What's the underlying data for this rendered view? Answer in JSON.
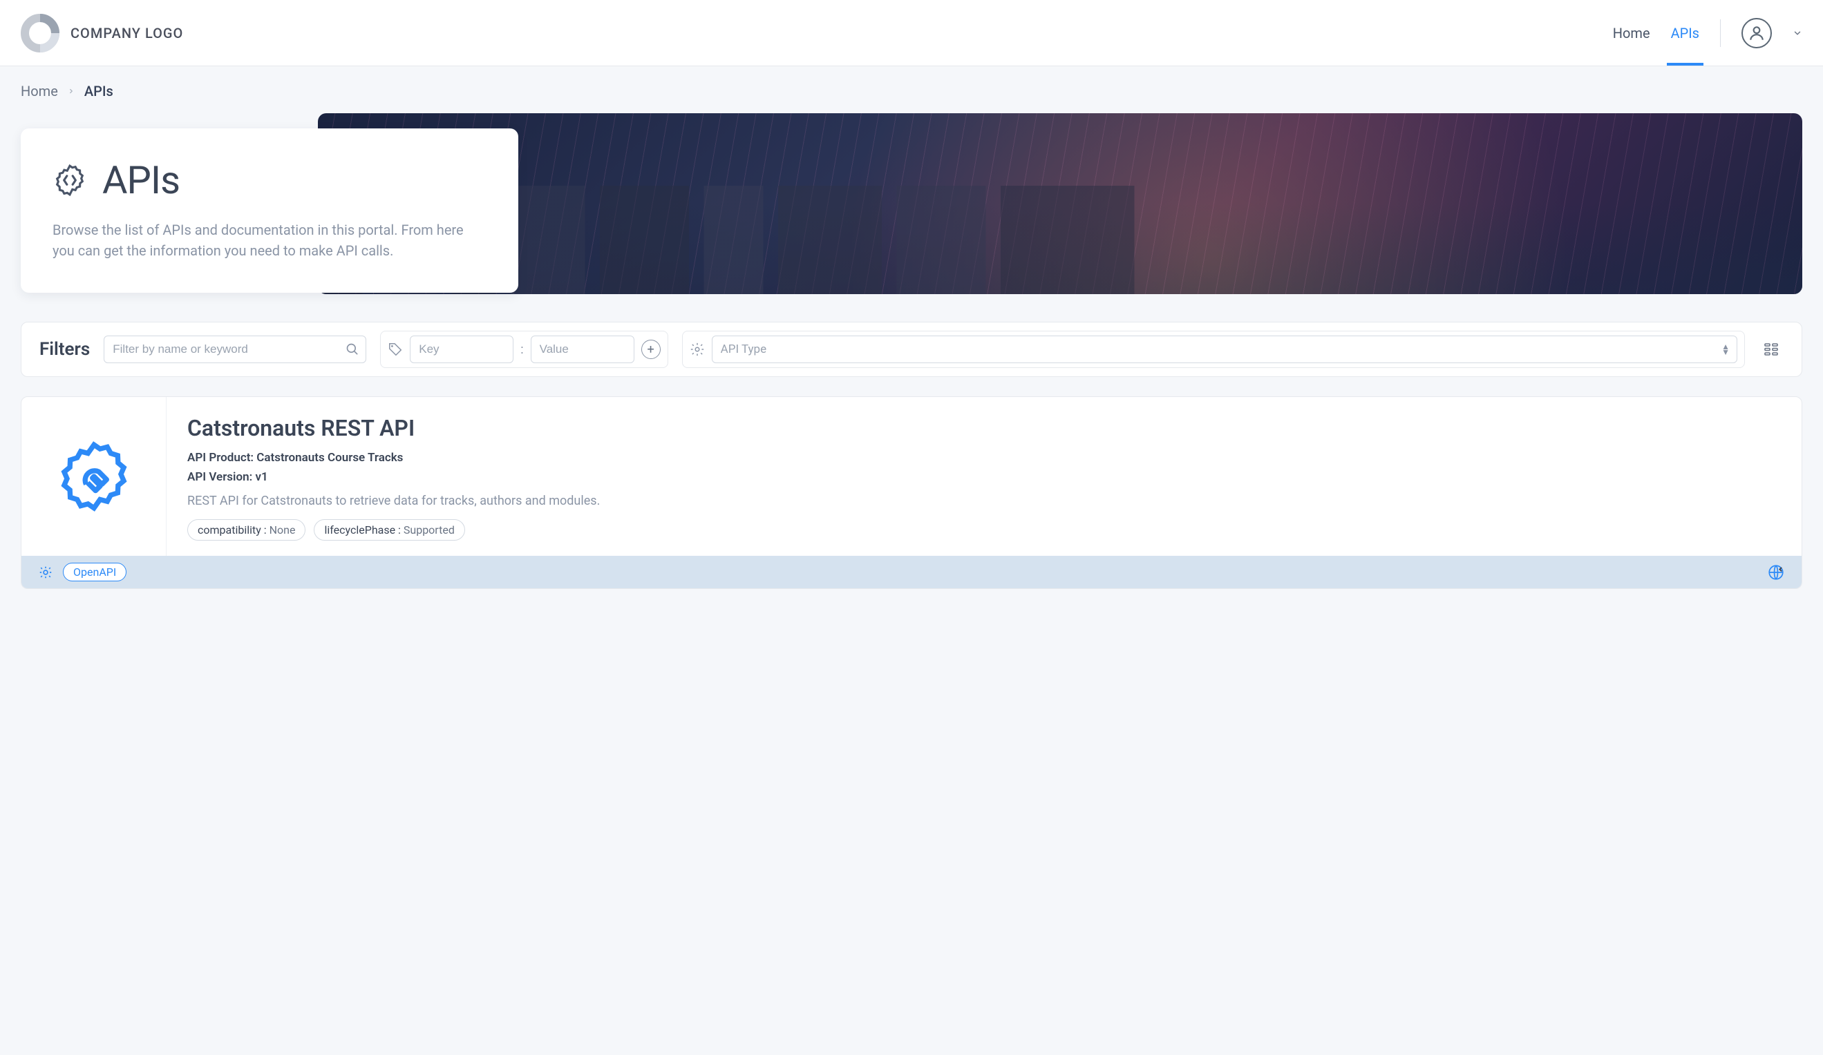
{
  "header": {
    "logo_text": "COMPANY LOGO",
    "nav": {
      "home": "Home",
      "apis": "APIs"
    }
  },
  "breadcrumb": {
    "home": "Home",
    "current": "APIs"
  },
  "hero": {
    "title": "APIs",
    "desc": "Browse the list of APIs and documentation in this portal. From here you can get the information you need to make API calls."
  },
  "filters": {
    "label": "Filters",
    "search_placeholder": "Filter by name or keyword",
    "key_placeholder": "Key",
    "value_placeholder": "Value",
    "api_type_placeholder": "API Type"
  },
  "result": {
    "title": "Catstronauts REST API",
    "product_label": "API Product: Catstronauts Course Tracks",
    "version_label": "API Version: v1",
    "description": "REST API for Catstronauts to retrieve data for tracks, authors and modules.",
    "tags": [
      {
        "key": "compatibility",
        "value": "None"
      },
      {
        "key": "lifecyclePhase",
        "value": "Supported"
      }
    ],
    "footer_badge": "OpenAPI"
  }
}
